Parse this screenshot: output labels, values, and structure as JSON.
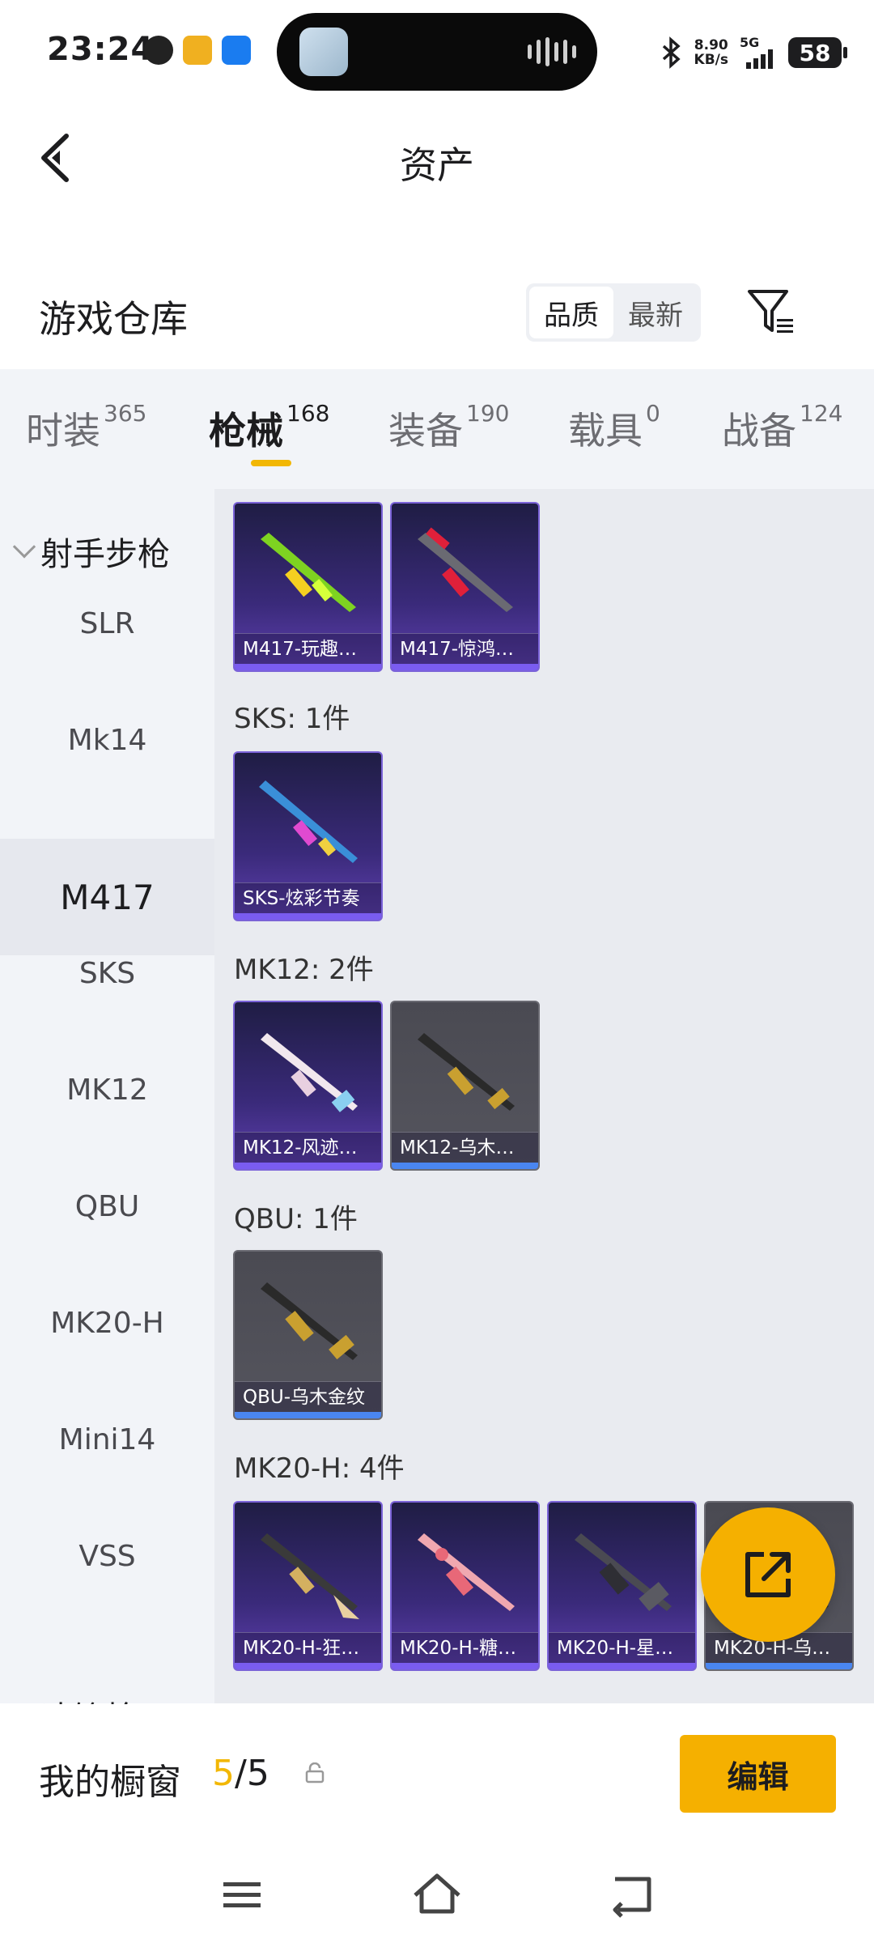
{
  "status_bar": {
    "time": "23:24",
    "net_speed": "8.90",
    "net_unit": "KB/s",
    "signal": "5G",
    "battery": "58"
  },
  "header": {
    "title": "资产"
  },
  "warehouse": {
    "title": "游戏仓库",
    "sort_options": [
      "品质",
      "最新"
    ]
  },
  "tabs": [
    {
      "label": "时装",
      "count": "365"
    },
    {
      "label": "枪械",
      "count": "168"
    },
    {
      "label": "装备",
      "count": "190"
    },
    {
      "label": "载具",
      "count": "0"
    },
    {
      "label": "战备",
      "count": "124"
    }
  ],
  "sidebar": {
    "group": "射手步枪",
    "items": [
      "SLR",
      "Mk14",
      "M417",
      "SKS",
      "MK12",
      "QBU",
      "MK20-H",
      "Mini14",
      "VSS"
    ],
    "next_group_partial": "冲锋枪"
  },
  "sections": [
    {
      "title": "",
      "cards": [
        "M417-玩趣…",
        "M417-惊鸿…"
      ]
    },
    {
      "title": "SKS: 1件",
      "cards": [
        "SKS-炫彩节奏"
      ]
    },
    {
      "title": "MK12: 2件",
      "cards": [
        "MK12-风迹…",
        "MK12-乌木…"
      ]
    },
    {
      "title": "QBU: 1件",
      "cards": [
        "QBU-乌木金纹"
      ]
    },
    {
      "title": "MK20-H: 4件",
      "cards": [
        "MK20-H-狂…",
        "MK20-H-糖…",
        "MK20-H-星…",
        "MK20-H-乌…"
      ]
    }
  ],
  "window": {
    "label": "我的橱窗",
    "current": "5",
    "sep": "/",
    "total": "5",
    "edit_label": "编辑"
  }
}
